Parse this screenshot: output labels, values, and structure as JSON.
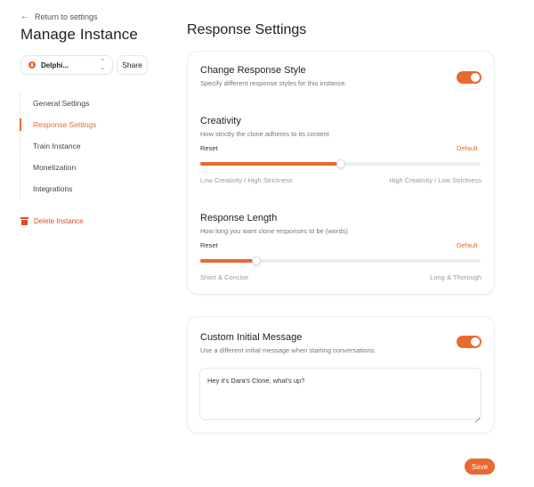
{
  "sidebar": {
    "back_label": "Return to settings",
    "title": "Manage Instance",
    "instance_name": "Delphi...",
    "share_label": "Share",
    "nav_items": [
      {
        "label": "General Settings",
        "active": false
      },
      {
        "label": "Response Settings",
        "active": true
      },
      {
        "label": "Train Instance",
        "active": false
      },
      {
        "label": "Monetization",
        "active": false
      },
      {
        "label": "Integrations",
        "active": false
      }
    ],
    "delete_label": "Delete Instance"
  },
  "main": {
    "title": "Response Settings",
    "response_style": {
      "title": "Change Response Style",
      "subtitle": "Specify different response styles for this instance.",
      "enabled": true
    },
    "creativity": {
      "title": "Creativity",
      "subtitle": "How strictly the clone adheres to its content",
      "reset_label": "Reset",
      "default_label": "Default",
      "value_percent": 50,
      "min_label": "Low Creativity / High Strictness",
      "max_label": "High Creativity / Low Strictness"
    },
    "response_length": {
      "title": "Response Length",
      "subtitle": "How long you want clone responses to be (words)",
      "reset_label": "Reset",
      "default_label": "Default",
      "value_percent": 20,
      "min_label": "Short & Concise",
      "max_label": "Long & Thorough"
    },
    "custom_message": {
      "title": "Custom Initial Message",
      "subtitle": "Use a different initial message when starting conversations.",
      "enabled": true,
      "message": "Hey it's Dara's Clone, what's up?"
    },
    "save_label": "Save"
  },
  "colors": {
    "accent": "#e86a2e",
    "danger": "#e0492f"
  },
  "icons": [
    "arrow-left-icon",
    "instance-icon",
    "chevron-up-down-icon",
    "trash-icon"
  ]
}
